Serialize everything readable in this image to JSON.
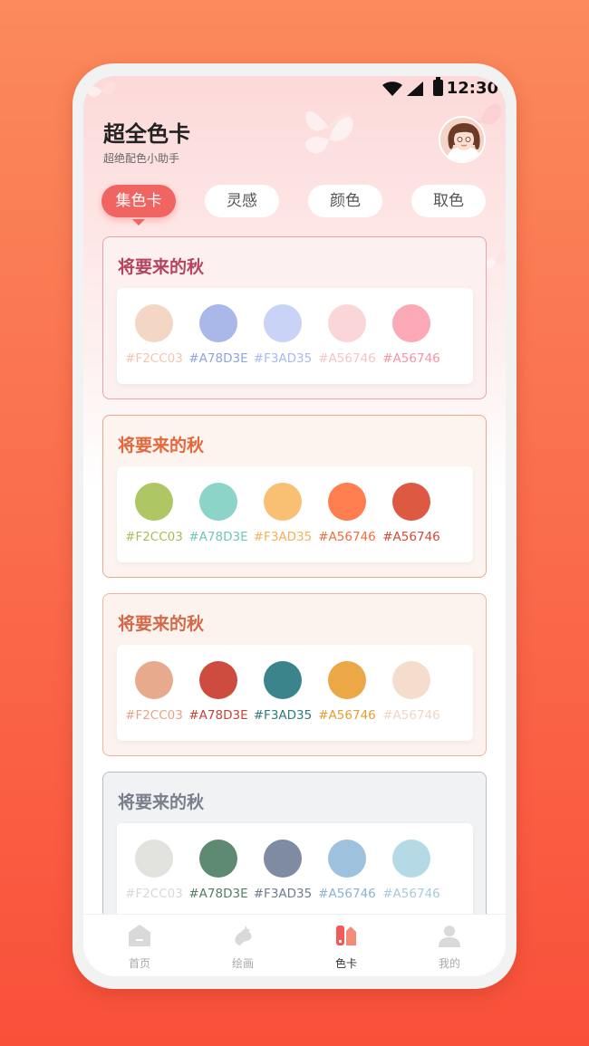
{
  "status_bar": {
    "time": "12:30"
  },
  "header": {
    "title": "超全色卡",
    "subtitle": "超绝配色小助手"
  },
  "tabs": [
    {
      "label": "集色卡",
      "active": true
    },
    {
      "label": "灵感",
      "active": false
    },
    {
      "label": "颜色",
      "active": false
    },
    {
      "label": "取色",
      "active": false
    }
  ],
  "cards": [
    {
      "title": "将要来的秋",
      "title_color": "#b5455c",
      "border_color": "#e9a3b0",
      "bg": "#fdf0f1",
      "swatches": [
        {
          "code": "#F2CC03",
          "dot": "#f3d7c4",
          "text": "#f1c6b1"
        },
        {
          "code": "#A78D3E",
          "dot": "#a9b8e8",
          "text": "#8fa3de"
        },
        {
          "code": "#F3AD35",
          "dot": "#c8d3f6",
          "text": "#a9b9ee"
        },
        {
          "code": "#A56746",
          "dot": "#fbd6d8",
          "text": "#f5c4c7"
        },
        {
          "code": "#A56746",
          "dot": "#fca9b7",
          "text": "#f694a6"
        }
      ]
    },
    {
      "title": "将要来的秋",
      "title_color": "#e2693d",
      "border_color": "#e8a98f",
      "bg": "#fdf3ef",
      "swatches": [
        {
          "code": "#F2CC03",
          "dot": "#aec764",
          "text": "#a3bf52"
        },
        {
          "code": "#A78D3E",
          "dot": "#8dd4c8",
          "text": "#6fc6b8"
        },
        {
          "code": "#F3AD35",
          "dot": "#f9c074",
          "text": "#f4b25c"
        },
        {
          "code": "#A56746",
          "dot": "#fe7e4f",
          "text": "#f46c3d"
        },
        {
          "code": "#A56746",
          "dot": "#dd5942",
          "text": "#d24b35"
        }
      ]
    },
    {
      "title": "将要来的秋",
      "title_color": "#d4694a",
      "border_color": "#eeb59f",
      "bg": "#fdf3ee",
      "swatches": [
        {
          "code": "#F2CC03",
          "dot": "#e8aa8c",
          "text": "#e7a386"
        },
        {
          "code": "#A78D3E",
          "dot": "#ce4b40",
          "text": "#c4443a"
        },
        {
          "code": "#F3AD35",
          "dot": "#3b848c",
          "text": "#2f7880"
        },
        {
          "code": "#A56746",
          "dot": "#eca846",
          "text": "#e69d36"
        },
        {
          "code": "#A56746",
          "dot": "#f4ddcc",
          "text": "#f1d6c5"
        }
      ]
    },
    {
      "title": "将要来的秋",
      "title_color": "#79808c",
      "border_color": "#b9bec5",
      "bg": "#f1f2f4",
      "swatches": [
        {
          "code": "#F2CC03",
          "dot": "#e2e2de",
          "text": "#d8d8d4"
        },
        {
          "code": "#A78D3E",
          "dot": "#5f8a72",
          "text": "#537d66"
        },
        {
          "code": "#F3AD35",
          "dot": "#7f8ba1",
          "text": "#6f7b91"
        },
        {
          "code": "#A56746",
          "dot": "#9ec1dd",
          "text": "#8db2d2"
        },
        {
          "code": "#A56746",
          "dot": "#b5dae6",
          "text": "#a5ccda"
        }
      ]
    }
  ],
  "tabbar": [
    {
      "label": "首页",
      "icon": "home-icon",
      "active": false
    },
    {
      "label": "绘画",
      "icon": "paint-icon",
      "active": false
    },
    {
      "label": "色卡",
      "icon": "color-card-icon",
      "active": true
    },
    {
      "label": "我的",
      "icon": "profile-icon",
      "active": false
    }
  ]
}
